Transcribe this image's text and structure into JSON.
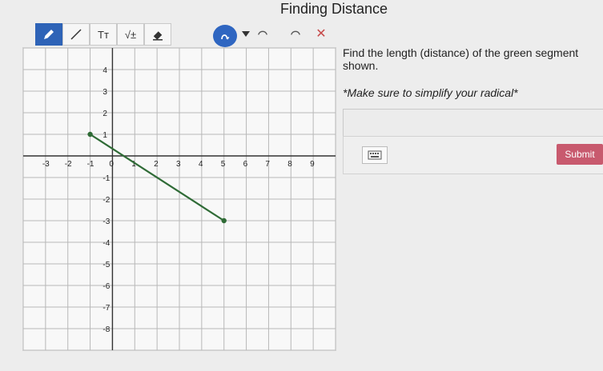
{
  "page": {
    "title": "Finding Distance"
  },
  "toolbar": {
    "items": [
      {
        "name": "pencil",
        "icon": "pencil-icon",
        "label": ""
      },
      {
        "name": "line",
        "icon": "line-icon",
        "label": ""
      },
      {
        "name": "text",
        "icon": "text-icon",
        "label": "Tт"
      },
      {
        "name": "sqrt",
        "icon": "sqrt-icon",
        "label": "√±"
      },
      {
        "name": "eraser",
        "icon": "eraser-icon",
        "label": ""
      }
    ],
    "active_color": "#2e63b7"
  },
  "question": {
    "text": "Find the length (distance) of the green segment shown.",
    "note": "*Make sure to simplify your radical*"
  },
  "answer": {
    "submit_label": "Submit",
    "submit_color": "#c85a6e",
    "keyboard_icon": "keyboard-icon"
  },
  "graph": {
    "x_ticks": [
      "-3",
      "-2",
      "-1",
      "0",
      "1",
      "2",
      "3",
      "4",
      "5",
      "6",
      "7",
      "8",
      "9"
    ],
    "y_ticks": [
      "4",
      "3",
      "2",
      "1",
      "-1",
      "-2",
      "-3",
      "-4",
      "-5",
      "-6",
      "-7",
      "-8"
    ],
    "segment": {
      "from": [
        -1,
        1
      ],
      "to": [
        5,
        -3
      ],
      "color": "#2f6b36"
    },
    "ranges": {
      "x": [
        -4,
        10
      ],
      "y": [
        -9,
        5
      ]
    }
  }
}
